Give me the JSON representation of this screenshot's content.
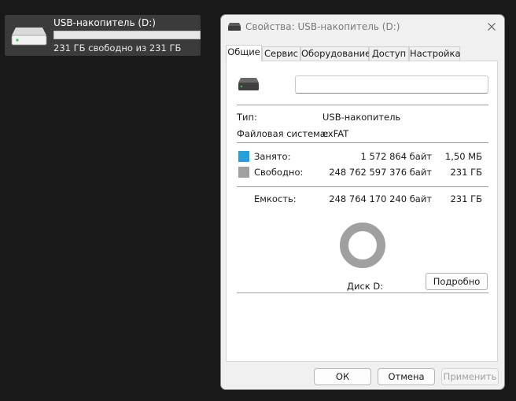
{
  "explorer": {
    "drive_name": "USB-накопитель (D:)",
    "drive_free": "231 ГБ свободно из 231 ГБ",
    "usage_fraction": 0.0
  },
  "dialog": {
    "title": "Свойства: USB-накопитель (D:)",
    "tabs": [
      {
        "label": "Общие",
        "active": true
      },
      {
        "label": "Сервис",
        "active": false
      },
      {
        "label": "Оборудование",
        "active": false
      },
      {
        "label": "Доступ",
        "active": false
      },
      {
        "label": "Настройка",
        "active": false
      }
    ],
    "general": {
      "volume_label_value": "",
      "type_label": "Тип:",
      "type_value": "USB-накопитель",
      "fs_label": "Файловая система:",
      "fs_value": "exFAT",
      "used_label": "Занято:",
      "used_bytes": "1 572 864 байт",
      "used_human": "1,50 МБ",
      "free_label": "Свободно:",
      "free_bytes": "248 762 597 376 байт",
      "free_human": "231 ГБ",
      "capacity_label": "Емкость:",
      "capacity_bytes": "248 764 170 240 байт",
      "capacity_human": "231 ГБ",
      "disk_label": "Диск D:",
      "details_button": "Подробно",
      "used_fraction": 6.3e-06
    },
    "buttons": {
      "ok": "ОК",
      "cancel": "Отмена",
      "apply": "Применить"
    }
  },
  "colors": {
    "used": "#26a0da",
    "free": "#a0a0a0"
  },
  "icons": {
    "drive": "drive-icon",
    "close": "close-icon"
  }
}
